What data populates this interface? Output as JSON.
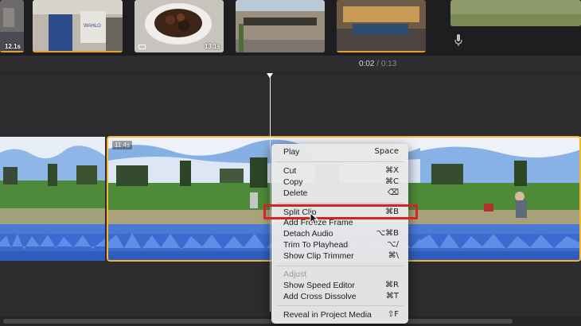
{
  "browser": {
    "clips": [
      {
        "duration": "12.1s"
      },
      {
        "duration": ""
      },
      {
        "duration": "13.1s"
      },
      {
        "duration": ""
      },
      {
        "duration": ""
      }
    ]
  },
  "timecode": {
    "current": "0:02",
    "separator": "/",
    "total": "0:13"
  },
  "timeline": {
    "selected_clip_duration": "11.4s"
  },
  "context_menu": {
    "items": [
      {
        "label": "Play",
        "shortcut": "Space"
      },
      {
        "label": "Cut",
        "shortcut": "⌘X"
      },
      {
        "label": "Copy",
        "shortcut": "⌘C"
      },
      {
        "label": "Delete",
        "shortcut": "⌫"
      },
      {
        "label": "Split Clip",
        "shortcut": "⌘B"
      },
      {
        "label": "Add Freeze Frame",
        "shortcut": ""
      },
      {
        "label": "Detach Audio",
        "shortcut": "⌥⌘B"
      },
      {
        "label": "Trim To Playhead",
        "shortcut": "⌥/"
      },
      {
        "label": "Show Clip Trimmer",
        "shortcut": "⌘\\"
      },
      {
        "label": "Adjust",
        "shortcut": ""
      },
      {
        "label": "Show Speed Editor",
        "shortcut": "⌘R"
      },
      {
        "label": "Add Cross Dissolve",
        "shortcut": "⌘T"
      },
      {
        "label": "Reveal in Project Media",
        "shortcut": "⇧F"
      }
    ]
  },
  "colors": {
    "selection": "#f2b632",
    "highlight_box": "#d62222",
    "audio": "#2f5dbd"
  }
}
